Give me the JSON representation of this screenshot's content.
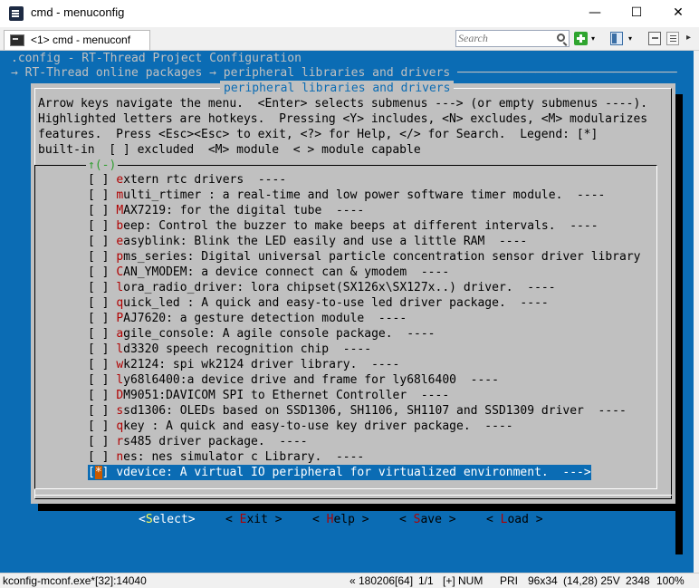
{
  "window": {
    "title": "cmd - menuconfig",
    "minimize": "—",
    "maximize": "☐",
    "close": "✕"
  },
  "tabbar": {
    "tab_label": "<1> cmd - menuconf",
    "search_placeholder": "Search",
    "caret": "▾"
  },
  "terminal": {
    "line1": ".config - RT-Thread Project Configuration",
    "line2": "→ RT-Thread online packages → peripheral libraries and drivers ───────────────────────────────",
    "dialog_title": "peripheral libraries and drivers",
    "help": [
      "Arrow keys navigate the menu.  <Enter> selects submenus ---> (or empty submenus ----).",
      "Highlighted letters are hotkeys.  Pressing <Y> includes, <N> excludes, <M> modularizes",
      "features.  Press <Esc><Esc> to exit, <?> for Help, </> for Search.  Legend: [*]",
      "built-in  [ ] excluded  <M> module  < > module capable"
    ],
    "scroll_indicator": "↑(-)",
    "items": [
      {
        "checkbox": "[ ] ",
        "hotkey": "e",
        "rest": "xtern rtc drivers  ----"
      },
      {
        "checkbox": "[ ] ",
        "hotkey": "m",
        "rest": "ulti_rtimer : a real-time and low power software timer module.  ----"
      },
      {
        "checkbox": "[ ] ",
        "hotkey": "M",
        "rest": "AX7219: for the digital tube  ----"
      },
      {
        "checkbox": "[ ] ",
        "hotkey": "b",
        "rest": "eep: Control the buzzer to make beeps at different intervals.  ----"
      },
      {
        "checkbox": "[ ] ",
        "hotkey": "e",
        "rest": "asyblink: Blink the LED easily and use a little RAM  ----"
      },
      {
        "checkbox": "[ ] ",
        "hotkey": "p",
        "rest": "ms_series: Digital universal particle concentration sensor driver library"
      },
      {
        "checkbox": "[ ] ",
        "hotkey": "C",
        "rest": "AN_YMODEM: a device connect can & ymodem  ----"
      },
      {
        "checkbox": "[ ] ",
        "hotkey": "l",
        "rest": "ora_radio_driver: lora chipset(SX126x\\SX127x..) driver.  ----"
      },
      {
        "checkbox": "[ ] ",
        "hotkey": "q",
        "rest": "uick_led : A quick and easy-to-use led driver package.  ----"
      },
      {
        "checkbox": "[ ] ",
        "hotkey": "P",
        "rest": "AJ7620: a gesture detection module  ----"
      },
      {
        "checkbox": "[ ] ",
        "hotkey": "a",
        "rest": "gile_console: A agile console package.  ----"
      },
      {
        "checkbox": "[ ] ",
        "hotkey": "l",
        "rest": "d3320 speech recognition chip  ----"
      },
      {
        "checkbox": "[ ] ",
        "hotkey": "w",
        "rest": "k2124: spi wk2124 driver library.  ----"
      },
      {
        "checkbox": "[ ] ",
        "hotkey": "l",
        "rest": "y68l6400:a device drive and frame for ly68l6400  ----"
      },
      {
        "checkbox": "[ ] ",
        "hotkey": "D",
        "rest": "M9051:DAVICOM SPI to Ethernet Controller  ----"
      },
      {
        "checkbox": "[ ] ",
        "hotkey": "s",
        "rest": "sd1306: OLEDs based on SSD1306, SH1106, SH1107 and SSD1309 driver  ----"
      },
      {
        "checkbox": "[ ] ",
        "hotkey": "q",
        "rest": "key : A quick and easy-to-use key driver package.  ----"
      },
      {
        "checkbox": "[ ] ",
        "hotkey": "r",
        "rest": "s485 driver package.  ----"
      },
      {
        "checkbox": "[ ] ",
        "hotkey": "n",
        "rest": "es: nes simulator c Library.  ----"
      },
      {
        "checkbox_open": "[",
        "checkbox_mark": "*",
        "checkbox_close": "] ",
        "hotkey": "v",
        "rest": "device: A virtual IO peripheral for virtualized environment.  --->",
        "selected": true
      }
    ],
    "buttons": [
      {
        "pre": "<",
        "hotkey": "S",
        "rest": "elect>",
        "active": true
      },
      {
        "pre": "< ",
        "hotkey": "E",
        "rest": "xit >"
      },
      {
        "pre": "< ",
        "hotkey": "H",
        "rest": "elp >"
      },
      {
        "pre": "< ",
        "hotkey": "S",
        "rest": "ave >"
      },
      {
        "pre": "< ",
        "hotkey": "L",
        "rest": "oad >"
      }
    ]
  },
  "statusbar": {
    "left": "kconfig-mconf.exe*[32]:14040",
    "pos1": "« 180206[64]",
    "pos2": "1/1",
    "pos3": "[+] NUM",
    "pos4": "PRI",
    "pos5": "96x34",
    "pos6": "(14,28) 25V",
    "pos7": "2348",
    "pos8": "100%"
  }
}
